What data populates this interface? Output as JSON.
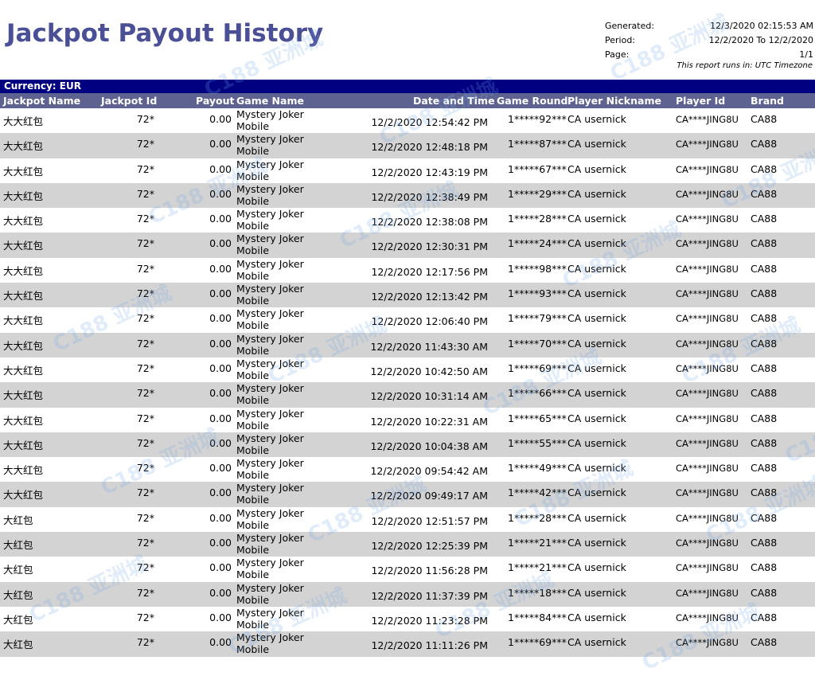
{
  "title": "Jackpot Payout History",
  "meta": {
    "generated_label": "Generated:",
    "generated_value": "12/3/2020 02:15:53 AM",
    "period_label": "Period:",
    "period_value": "12/2/2020 To 12/2/2020",
    "page_label": "Page:",
    "page_value": "1/1",
    "timezone_note": "This report runs in: UTC Timezone"
  },
  "currency": "Currency: EUR",
  "columns": {
    "jackpot_name": "Jackpot Name",
    "jackpot_id": "Jackpot Id",
    "payout": "Payout",
    "game_name": "Game Name",
    "date_time": "Date and Time",
    "game_round": "Game Round",
    "player_nickname": "Player Nickname",
    "player_id": "Player Id",
    "brand": "Brand"
  },
  "rows": [
    {
      "name": "大大红包",
      "id": "72*",
      "payout": "0.00",
      "game1": "Mystery Joker",
      "game2": "Mobile",
      "date": "12/2/2020 12:54:42 PM",
      "round": "1*****92***",
      "nick": "CA usernick",
      "pid": "CA****JING8U",
      "brand": "CA88"
    },
    {
      "name": "大大红包",
      "id": "72*",
      "payout": "0.00",
      "game1": "Mystery Joker",
      "game2": "Mobile",
      "date": "12/2/2020 12:48:18 PM",
      "round": "1*****87***",
      "nick": "CA usernick",
      "pid": "CA****JING8U",
      "brand": "CA88"
    },
    {
      "name": "大大红包",
      "id": "72*",
      "payout": "0.00",
      "game1": "Mystery Joker",
      "game2": "Mobile",
      "date": "12/2/2020 12:43:19 PM",
      "round": "1*****67***",
      "nick": "CA usernick",
      "pid": "CA****JING8U",
      "brand": "CA88"
    },
    {
      "name": "大大红包",
      "id": "72*",
      "payout": "0.00",
      "game1": "Mystery Joker",
      "game2": "Mobile",
      "date": "12/2/2020 12:38:49 PM",
      "round": "1*****29***",
      "nick": "CA usernick",
      "pid": "CA****JING8U",
      "brand": "CA88"
    },
    {
      "name": "大大红包",
      "id": "72*",
      "payout": "0.00",
      "game1": "Mystery Joker",
      "game2": "Mobile",
      "date": "12/2/2020 12:38:08 PM",
      "round": "1*****28***",
      "nick": "CA usernick",
      "pid": "CA****JING8U",
      "brand": "CA88"
    },
    {
      "name": "大大红包",
      "id": "72*",
      "payout": "0.00",
      "game1": "Mystery Joker",
      "game2": "Mobile",
      "date": "12/2/2020 12:30:31 PM",
      "round": "1*****24***",
      "nick": "CA usernick",
      "pid": "CA****JING8U",
      "brand": "CA88"
    },
    {
      "name": "大大红包",
      "id": "72*",
      "payout": "0.00",
      "game1": "Mystery Joker",
      "game2": "Mobile",
      "date": "12/2/2020 12:17:56 PM",
      "round": "1*****98***",
      "nick": "CA usernick",
      "pid": "CA****JING8U",
      "brand": "CA88"
    },
    {
      "name": "大大红包",
      "id": "72*",
      "payout": "0.00",
      "game1": "Mystery Joker",
      "game2": "Mobile",
      "date": "12/2/2020 12:13:42 PM",
      "round": "1*****93***",
      "nick": "CA usernick",
      "pid": "CA****JING8U",
      "brand": "CA88"
    },
    {
      "name": "大大红包",
      "id": "72*",
      "payout": "0.00",
      "game1": "Mystery Joker",
      "game2": "Mobile",
      "date": "12/2/2020 12:06:40 PM",
      "round": "1*****79***",
      "nick": "CA usernick",
      "pid": "CA****JING8U",
      "brand": "CA88"
    },
    {
      "name": "大大红包",
      "id": "72*",
      "payout": "0.00",
      "game1": "Mystery Joker",
      "game2": "Mobile",
      "date": "12/2/2020 11:43:30 AM",
      "round": "1*****70***",
      "nick": "CA usernick",
      "pid": "CA****JING8U",
      "brand": "CA88"
    },
    {
      "name": "大大红包",
      "id": "72*",
      "payout": "0.00",
      "game1": "Mystery Joker",
      "game2": "Mobile",
      "date": "12/2/2020 10:42:50 AM",
      "round": "1*****69***",
      "nick": "CA usernick",
      "pid": "CA****JING8U",
      "brand": "CA88"
    },
    {
      "name": "大大红包",
      "id": "72*",
      "payout": "0.00",
      "game1": "Mystery Joker",
      "game2": "Mobile",
      "date": "12/2/2020 10:31:14 AM",
      "round": "1*****66***",
      "nick": "CA usernick",
      "pid": "CA****JING8U",
      "brand": "CA88"
    },
    {
      "name": "大大红包",
      "id": "72*",
      "payout": "0.00",
      "game1": "Mystery Joker",
      "game2": "Mobile",
      "date": "12/2/2020 10:22:31 AM",
      "round": "1*****65***",
      "nick": "CA usernick",
      "pid": "CA****JING8U",
      "brand": "CA88"
    },
    {
      "name": "大大红包",
      "id": "72*",
      "payout": "0.00",
      "game1": "Mystery Joker",
      "game2": "Mobile",
      "date": "12/2/2020 10:04:38 AM",
      "round": "1*****55***",
      "nick": "CA usernick",
      "pid": "CA****JING8U",
      "brand": "CA88"
    },
    {
      "name": "大大红包",
      "id": "72*",
      "payout": "0.00",
      "game1": "Mystery Joker",
      "game2": "Mobile",
      "date": "12/2/2020 09:54:42 AM",
      "round": "1*****49***",
      "nick": "CA usernick",
      "pid": "CA****JING8U",
      "brand": "CA88"
    },
    {
      "name": "大大红包",
      "id": "72*",
      "payout": "0.00",
      "game1": "Mystery Joker",
      "game2": "Mobile",
      "date": "12/2/2020 09:49:17 AM",
      "round": "1*****42***",
      "nick": "CA usernick",
      "pid": "CA****JING8U",
      "brand": "CA88"
    },
    {
      "name": "大红包",
      "id": "72*",
      "payout": "0.00",
      "game1": "Mystery Joker",
      "game2": "Mobile",
      "date": "12/2/2020 12:51:57 PM",
      "round": "1*****28***",
      "nick": "CA usernick",
      "pid": "CA****JING8U",
      "brand": "CA88"
    },
    {
      "name": "大红包",
      "id": "72*",
      "payout": "0.00",
      "game1": "Mystery Joker",
      "game2": "Mobile",
      "date": "12/2/2020 12:25:39 PM",
      "round": "1*****21***",
      "nick": "CA usernick",
      "pid": "CA****JING8U",
      "brand": "CA88"
    },
    {
      "name": "大红包",
      "id": "72*",
      "payout": "0.00",
      "game1": "Mystery Joker",
      "game2": "Mobile",
      "date": "12/2/2020 11:56:28 PM",
      "round": "1*****21***",
      "nick": "CA usernick",
      "pid": "CA****JING8U",
      "brand": "CA88"
    },
    {
      "name": "大红包",
      "id": "72*",
      "payout": "0.00",
      "game1": "Mystery Joker",
      "game2": "Mobile",
      "date": "12/2/2020 11:37:39 PM",
      "round": "1*****18***",
      "nick": "CA usernick",
      "pid": "CA****JING8U",
      "brand": "CA88"
    },
    {
      "name": "大红包",
      "id": "72*",
      "payout": "0.00",
      "game1": "Mystery Joker",
      "game2": "Mobile",
      "date": "12/2/2020 11:23:28 PM",
      "round": "1*****84***",
      "nick": "CA usernick",
      "pid": "CA****JING8U",
      "brand": "CA88"
    },
    {
      "name": "大红包",
      "id": "72*",
      "payout": "0.00",
      "game1": "Mystery Joker",
      "game2": "Mobile",
      "date": "12/2/2020 11:11:26 PM",
      "round": "1*****69***",
      "nick": "CA usernick",
      "pid": "CA****JING8U",
      "brand": "CA88"
    }
  ],
  "watermark": "C188 亚洲城"
}
